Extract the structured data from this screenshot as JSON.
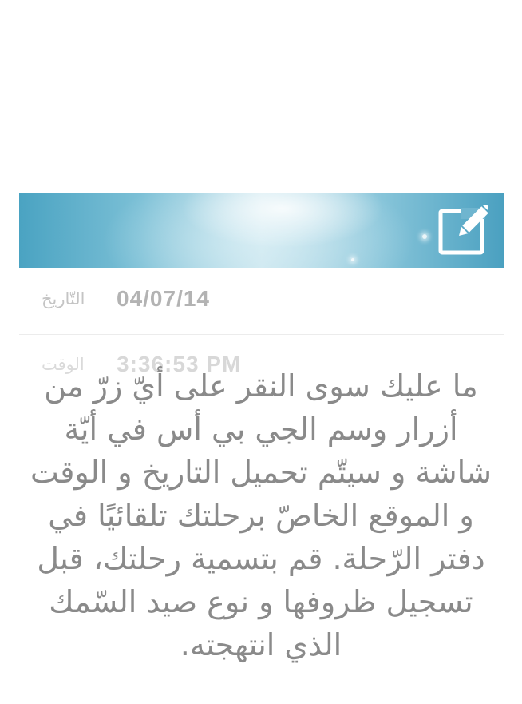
{
  "header": {
    "edit_icon": "edit-icon",
    "colors": {
      "banner_light": "#c9e5ee",
      "banner_dark": "#4aa3c2",
      "icon": "#ffffff"
    }
  },
  "fields": {
    "date": {
      "label": "التّاريخ",
      "value": "04/07/14"
    },
    "time": {
      "label": "الوقت",
      "value": "3:36:53 PM"
    }
  },
  "instructions": {
    "text": "ما عليك سوى النقر على أيّ زرّ من أزرار وسم الجي بي أس في أيّة شاشة و سيتّم تحميل التاريخ و الوقت و الموقع الخاصّ برحلتك تلقائيًا في دفتر الرّحلة. قم بتسمية رحلتك، قبل تسجيل ظروفها و نوع صيد السّمك الذي انتهجته."
  }
}
